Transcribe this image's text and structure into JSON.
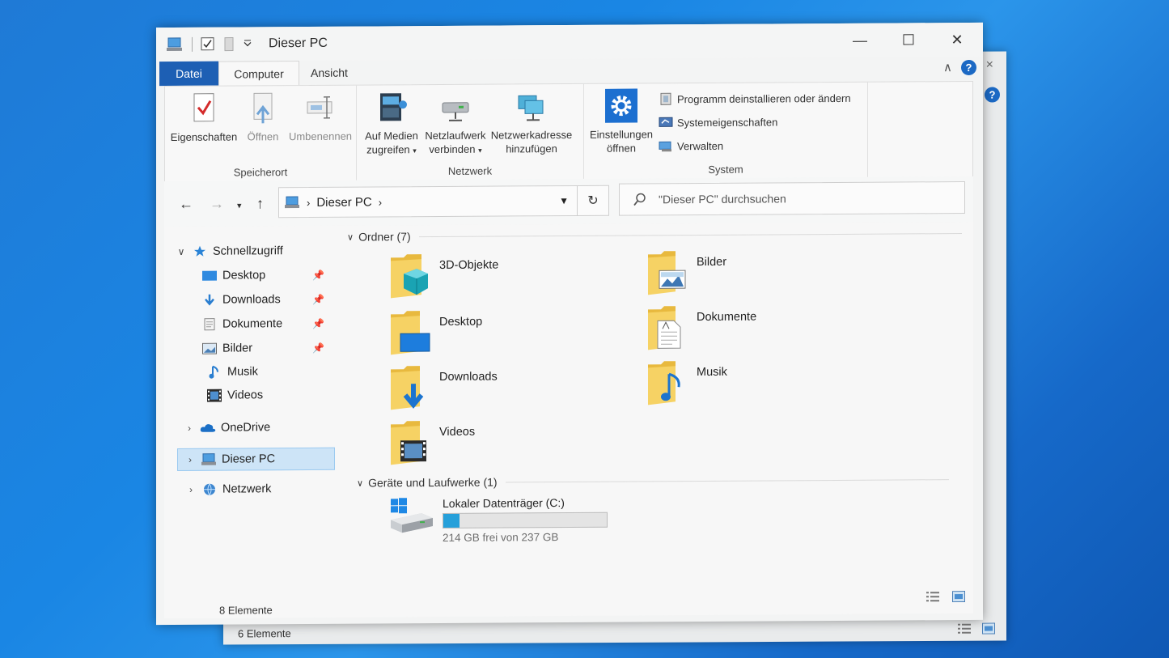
{
  "back_window": {
    "status": "6 Elemente",
    "help": "?",
    "close": "×"
  },
  "window": {
    "title": "Dieser PC",
    "controls": {
      "minimize": "—",
      "maximize": "☐",
      "close": "✕"
    }
  },
  "tabs": {
    "file": "Datei",
    "computer": "Computer",
    "view": "Ansicht"
  },
  "ribbon": {
    "collapse": "∧",
    "help": "?",
    "groups": {
      "location": {
        "label": "Speicherort",
        "properties": "Eigenschaften",
        "open": "Öffnen",
        "rename": "Umbenennen"
      },
      "network": {
        "label": "Netzwerk",
        "media_1": "Auf Medien",
        "media_2": "zugreifen",
        "drive_1": "Netzlaufwerk",
        "drive_2": "verbinden",
        "addr_1": "Netzwerkadresse",
        "addr_2": "hinzufügen"
      },
      "system": {
        "label": "System",
        "settings_1": "Einstellungen",
        "settings_2": "öffnen",
        "uninstall": "Programm deinstallieren oder ändern",
        "sysprops": "Systemeigenschaften",
        "manage": "Verwalten"
      }
    }
  },
  "nav": {
    "address": "Dieser PC",
    "search_placeholder": "\"Dieser PC\" durchsuchen"
  },
  "sidebar": {
    "quick_access": "Schnellzugriff",
    "items": [
      "Desktop",
      "Downloads",
      "Dokumente",
      "Bilder",
      "Musik",
      "Videos"
    ],
    "onedrive": "OneDrive",
    "this_pc": "Dieser PC",
    "network": "Netzwerk"
  },
  "main": {
    "folders_header": "Ordner (7)",
    "folders": {
      "objects3d": "3D-Objekte",
      "pictures": "Bilder",
      "desktop": "Desktop",
      "documents": "Dokumente",
      "downloads": "Downloads",
      "music": "Musik",
      "videos": "Videos"
    },
    "devices_header": "Geräte und Laufwerke (1)",
    "drive": {
      "name": "Lokaler Datenträger (C:)",
      "free": "214 GB frei von 237 GB",
      "used_fraction": 0.097
    }
  },
  "status": "8 Elemente",
  "colors": {
    "accent": "#1d5fb4",
    "selection": "#cde4f7",
    "drive_bar": "#26a0da"
  }
}
